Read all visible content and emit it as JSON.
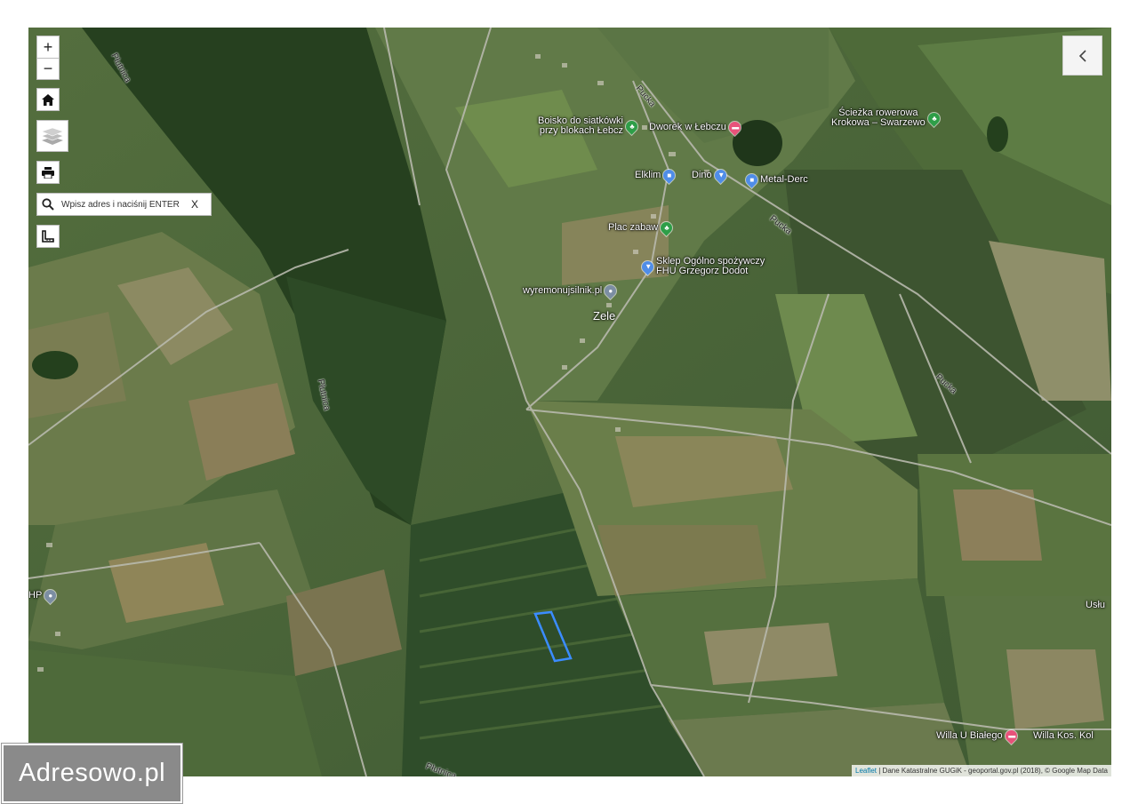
{
  "controls": {
    "zoom_in": "+",
    "zoom_out": "−",
    "search_placeholder": "Wpisz adres i naciśnij ENTER",
    "search_clear": "X",
    "panel_toggle": "‹"
  },
  "map": {
    "places": [
      {
        "id": "zele",
        "label": "Zele"
      }
    ],
    "roads": [
      {
        "id": "pucka1",
        "label": "Pucka"
      },
      {
        "id": "pucka2",
        "label": "Pucka"
      },
      {
        "id": "pucka3",
        "label": "Pucka"
      },
      {
        "id": "plutnica1",
        "label": "Płutnica"
      },
      {
        "id": "plutnica2",
        "label": "Płutnica"
      },
      {
        "id": "plutnica3",
        "label": "Płutnica"
      }
    ],
    "pois": [
      {
        "id": "boisko",
        "label": "Boisko do siatkówki\nprzy blokach Łebcz",
        "color": "green",
        "icon": "tree-icon"
      },
      {
        "id": "dworek",
        "label": "Dworek w Łebczu",
        "color": "pink",
        "icon": "bed-icon"
      },
      {
        "id": "sciezka",
        "label": "Ścieżka rowerowa\nKrokowa – Swarzewo",
        "color": "green",
        "icon": "tree-icon"
      },
      {
        "id": "elklim",
        "label": "Elklim",
        "color": "blue",
        "icon": "shop-icon"
      },
      {
        "id": "dino",
        "label": "Dino",
        "color": "blue",
        "icon": "cart-icon"
      },
      {
        "id": "metal",
        "label": "Metal-Derc",
        "color": "blue",
        "icon": "store-icon"
      },
      {
        "id": "plac",
        "label": "Plac zabaw",
        "color": "green",
        "icon": "tree-icon"
      },
      {
        "id": "sklep",
        "label": "Sklep Ogólno spożywczy\nFHU Grzegorz Dodot",
        "color": "blue",
        "icon": "cart-icon"
      },
      {
        "id": "wyremonuj",
        "label": "wyremonujsilnik.pl",
        "color": "gray",
        "icon": "wrench-icon"
      },
      {
        "id": "hp",
        "label": "HP",
        "color": "gray",
        "icon": "pin-icon"
      },
      {
        "id": "willa-bialego",
        "label": "Willa U Białego",
        "color": "pink",
        "icon": "bed-icon"
      },
      {
        "id": "willa-kos",
        "label": "Willa Kos. Kol",
        "color": "pink",
        "icon": "bed-icon"
      },
      {
        "id": "uslu",
        "label": "Usłu",
        "color": "gray",
        "icon": "pin-icon"
      }
    ]
  },
  "attribution": {
    "leaflet": "Leaflet",
    "rest": " | Dane Katastralne GUGiK - geoportal.gov.pl (2018), © Google Map Data"
  },
  "brand": {
    "text": "Adresowo.pl"
  }
}
